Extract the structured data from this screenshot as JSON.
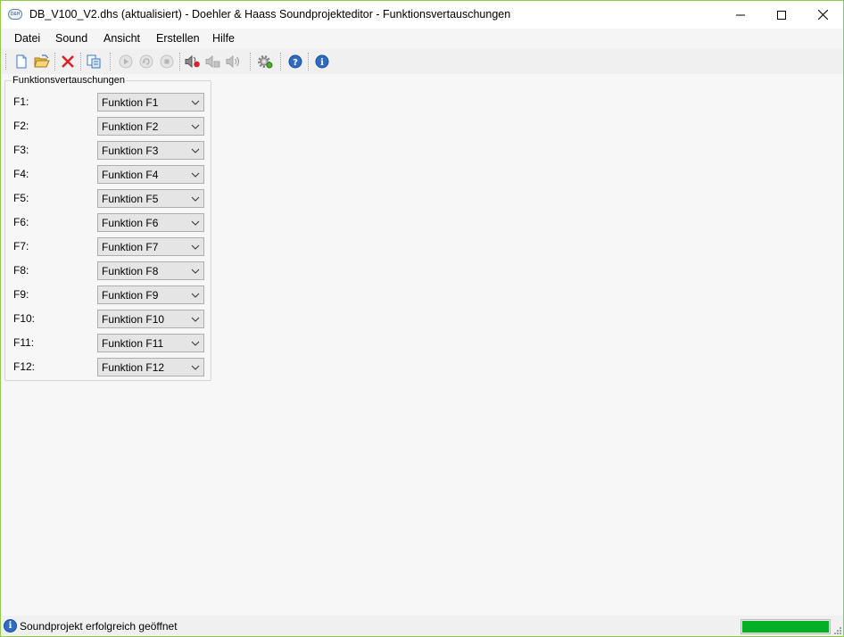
{
  "window": {
    "title": "DB_V100_V2.dhs (aktualisiert) - Doehler & Haass Soundprojekteditor - Funktionsvertauschungen",
    "app_icon_text": "D&H",
    "accent_color": "#8fce4a"
  },
  "menu": {
    "items": [
      "Datei",
      "Sound",
      "Ansicht",
      "Erstellen",
      "Hilfe"
    ]
  },
  "toolbar": {
    "buttons": [
      {
        "name": "new-icon",
        "enabled": true
      },
      {
        "name": "open-folder-icon",
        "enabled": true
      },
      {
        "name": "delete-icon",
        "enabled": true
      },
      {
        "name": "copy-icon",
        "enabled": true
      },
      {
        "name": "play-icon",
        "enabled": false
      },
      {
        "name": "loop-icon",
        "enabled": false
      },
      {
        "name": "stop-icon",
        "enabled": false
      },
      {
        "name": "speaker-record-icon",
        "enabled": true
      },
      {
        "name": "speaker-mute-icon",
        "enabled": false
      },
      {
        "name": "speaker-icon",
        "enabled": false
      },
      {
        "name": "settings-gear-icon",
        "enabled": true
      },
      {
        "name": "help-icon",
        "enabled": true
      },
      {
        "name": "info-icon",
        "enabled": true
      }
    ]
  },
  "group": {
    "title": "Funktionsvertauschungen",
    "rows": [
      {
        "label": "F1:",
        "value": "Funktion F1"
      },
      {
        "label": "F2:",
        "value": "Funktion F2"
      },
      {
        "label": "F3:",
        "value": "Funktion F3"
      },
      {
        "label": "F4:",
        "value": "Funktion F4"
      },
      {
        "label": "F5:",
        "value": "Funktion F5"
      },
      {
        "label": "F6:",
        "value": "Funktion F6"
      },
      {
        "label": "F7:",
        "value": "Funktion F7"
      },
      {
        "label": "F8:",
        "value": "Funktion F8"
      },
      {
        "label": "F9:",
        "value": "Funktion F9"
      },
      {
        "label": "F10:",
        "value": "Funktion F10"
      },
      {
        "label": "F11:",
        "value": "Funktion F11"
      },
      {
        "label": "F12:",
        "value": "Funktion F12"
      }
    ]
  },
  "status": {
    "icon": "info-icon",
    "text": "Soundprojekt erfolgreich geöffnet",
    "progress_percent": 100,
    "progress_color": "#06b025"
  }
}
